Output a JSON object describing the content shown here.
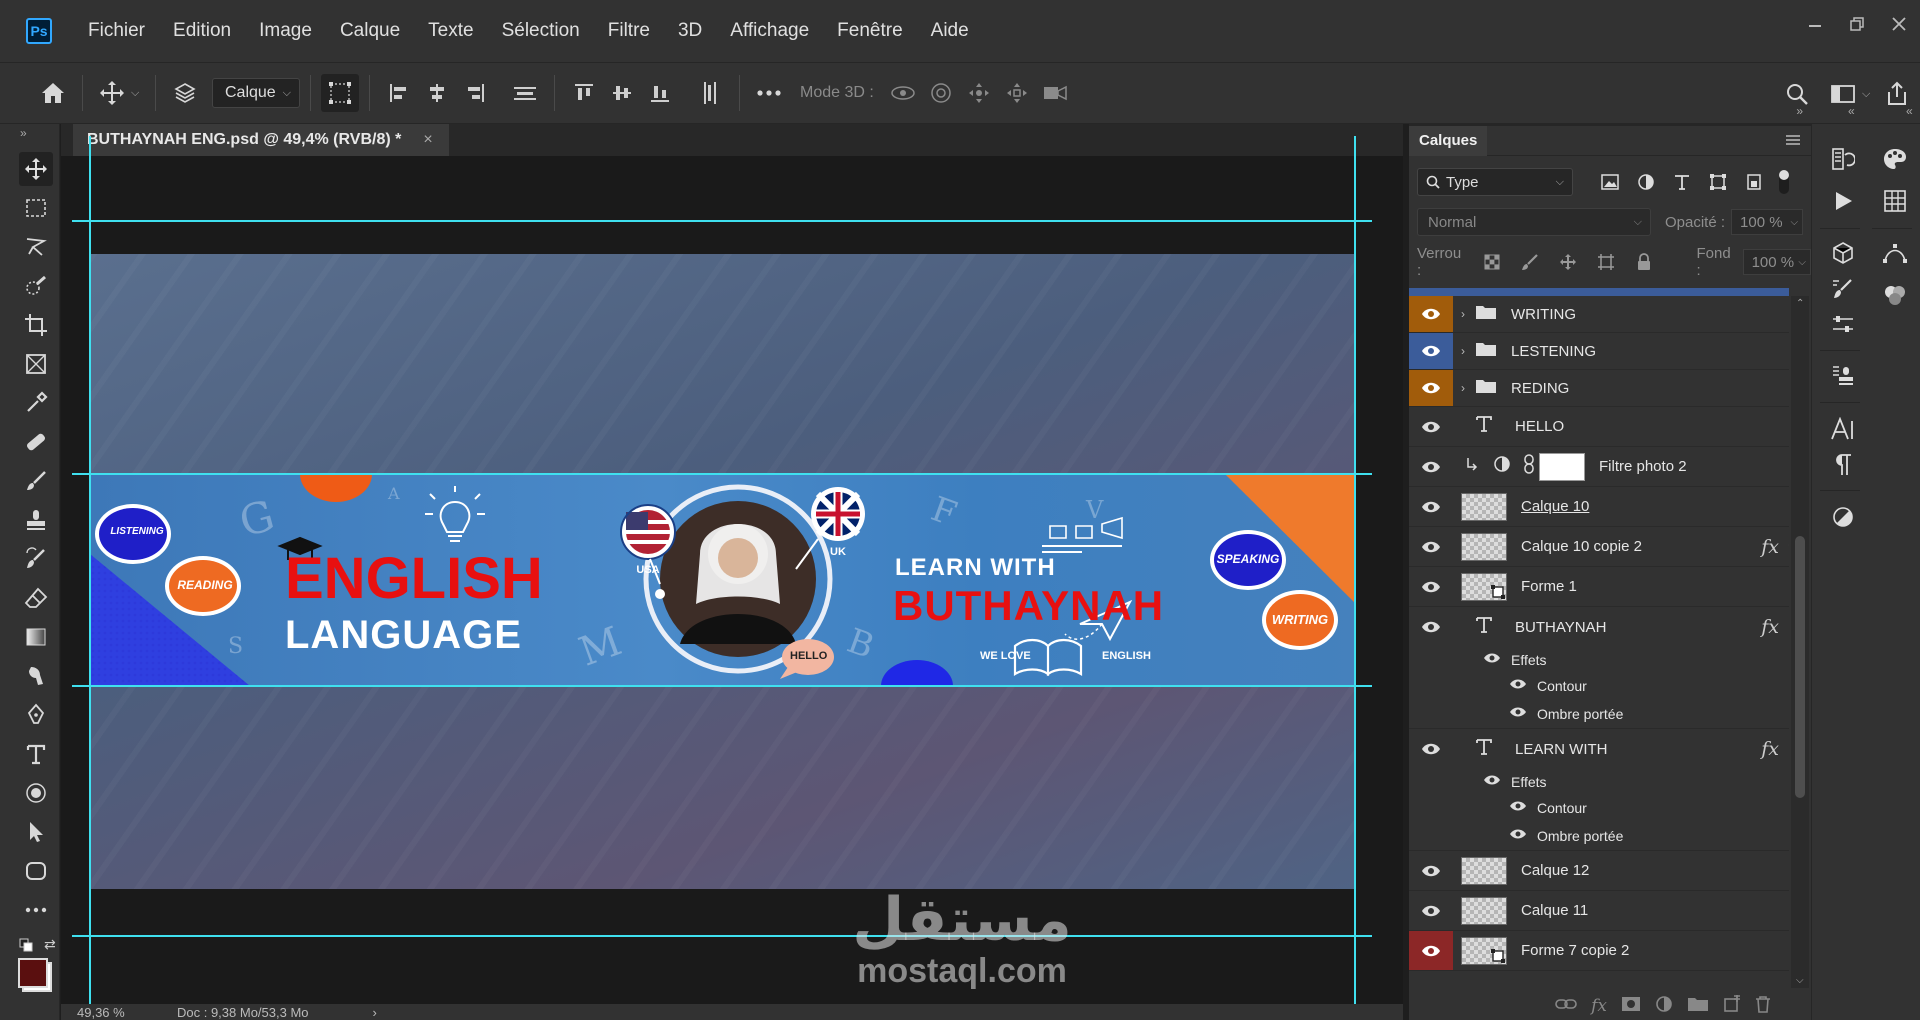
{
  "menu": {
    "logo": "Ps",
    "items": [
      "Fichier",
      "Edition",
      "Image",
      "Calque",
      "Texte",
      "Sélection",
      "Filtre",
      "3D",
      "Affichage",
      "Fenêtre",
      "Aide"
    ]
  },
  "options_bar": {
    "auto_select_value": "Calque",
    "mode3d_label": "Mode 3D :"
  },
  "document": {
    "tab_title": "BUTHAYNAH ENG.psd @ 49,4% (RVB/8) *",
    "tab_close": "×",
    "zoom_status": "49,36 %",
    "doc_status": "Doc : 9,38 Mo/53,3 Mo"
  },
  "banner": {
    "title_line1": "ENGLISH",
    "title_line2": "LANGUAGE",
    "learn_with": "LEARN WITH",
    "name": "BUTHAYNAH",
    "we_love": "WE LOVE",
    "english": "ENGLISH",
    "hello_bubble": "HELLO",
    "usa": "USA",
    "uk": "UK",
    "badges": {
      "listening": "LISTENING",
      "reading": "READING",
      "speaking": "SPEAKING",
      "writing": "WRITING"
    },
    "letters": [
      "G",
      "S",
      "M",
      "B",
      "F",
      "V",
      "A"
    ]
  },
  "watermark": {
    "arabic": "مستقل",
    "latin": "mostaql.com"
  },
  "layers_panel": {
    "title": "Calques",
    "filter_label": "Type",
    "blend_mode": "Normal",
    "opacity_label": "Opacité :",
    "opacity_value": "100 %",
    "lock_label": "Verrou :",
    "fill_label": "Fond :",
    "fill_value": "100 %",
    "layers": [
      {
        "name": "WRITING",
        "kind": "folder",
        "color": "#a15c0b"
      },
      {
        "name": "LESTENING",
        "kind": "folder",
        "color": "#3b5c9a"
      },
      {
        "name": "REDING",
        "kind": "folder",
        "color": "#a15c0b"
      },
      {
        "name": "HELLO",
        "kind": "text"
      },
      {
        "name": "Filtre photo 2",
        "kind": "adjustment"
      },
      {
        "name": "Calque 10",
        "kind": "pixel"
      },
      {
        "name": "Calque 10 copie 2",
        "kind": "pixel",
        "fx": "fx"
      },
      {
        "name": "Forme 1",
        "kind": "shape"
      },
      {
        "name": "BUTHAYNAH",
        "kind": "text",
        "fx": "fx"
      },
      {
        "name": "Effets",
        "kind": "effects"
      },
      {
        "name": "Contour",
        "kind": "effect"
      },
      {
        "name": "Ombre portée",
        "kind": "effect"
      },
      {
        "name": "LEARN WITH",
        "kind": "text",
        "fx": "fx"
      },
      {
        "name": "Effets",
        "kind": "effects"
      },
      {
        "name": "Contour",
        "kind": "effect"
      },
      {
        "name": "Ombre portée",
        "kind": "effect"
      },
      {
        "name": "Calque 12",
        "kind": "pixel"
      },
      {
        "name": "Calque 11",
        "kind": "pixel"
      },
      {
        "name": "Forme 7 copie 2",
        "kind": "shape",
        "color": "#8c2727"
      }
    ]
  },
  "colors": {
    "accent": "#31a8ff",
    "guide": "#3fe0ef",
    "foreground": "#5a0f0f",
    "background": "#ffffff"
  }
}
